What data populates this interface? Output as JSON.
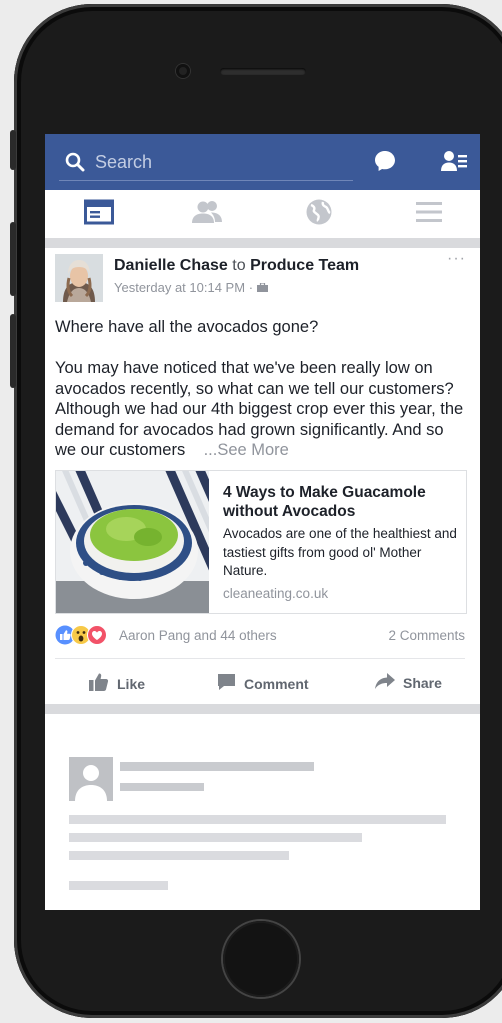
{
  "search": {
    "placeholder": "Search"
  },
  "nav": {
    "tabs": [
      {
        "name": "news-feed",
        "active": true
      },
      {
        "name": "friends",
        "active": false
      },
      {
        "name": "notifications-globe",
        "active": false
      },
      {
        "name": "menu",
        "active": false
      }
    ]
  },
  "post": {
    "author": "Danielle Chase",
    "to_word": "to",
    "group": "Produce Team",
    "timestamp": "Yesterday at 10:14 PM",
    "meta_separator": "·",
    "privacy_icon": "briefcase-icon",
    "more_glyph": "···",
    "text_line1": "Where have all the avocados gone?",
    "text_body": "You may have noticed that we've been really low on avocados recently, so what can we tell our customers? Although we had our 4th biggest crop ever this year, the demand for avocados had grown significantly. And so we our customers",
    "see_more": "...See More",
    "link": {
      "title": "4 Ways to Make Guacamole without Avocados",
      "description": "Avocados are one of the healthiest and tastiest gifts from good ol' Mother Nature.",
      "domain": "cleaneating.co.uk"
    },
    "reactions": {
      "icons": [
        "like-reaction-icon",
        "wow-reaction-icon",
        "love-reaction-icon"
      ],
      "names": "Aaron Pang and 44 others",
      "comments": "2 Comments"
    },
    "actions": {
      "like": "Like",
      "comment": "Comment",
      "share": "Share"
    }
  },
  "colors": {
    "brand": "#3b5998",
    "text": "#1d2129",
    "muted": "#90949c",
    "separator": "#d9dadd"
  }
}
